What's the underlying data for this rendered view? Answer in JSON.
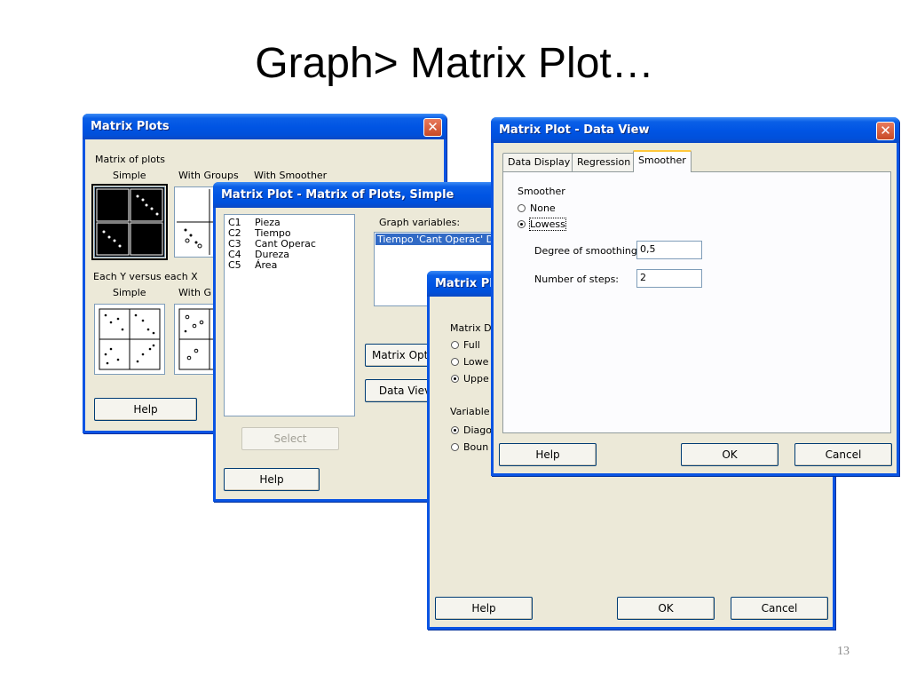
{
  "slide": {
    "title": "Graph> Matrix Plot…",
    "page_number": "13"
  },
  "matrix_plots": {
    "title": "Matrix Plots",
    "section1_label": "Matrix of plots",
    "col_simple": "Simple",
    "col_groups": "With Groups",
    "col_smoother": "With Smoother",
    "section2_label": "Each Y versus each X",
    "col2_simple": "Simple",
    "col2_groups": "With G",
    "help": "Help"
  },
  "matrix_simple": {
    "title": "Matrix Plot - Matrix of Plots, Simple",
    "columns": [
      {
        "id": "C1",
        "name": "Pieza"
      },
      {
        "id": "C2",
        "name": "Tiempo"
      },
      {
        "id": "C3",
        "name": "Cant Operac"
      },
      {
        "id": "C4",
        "name": "Dureza"
      },
      {
        "id": "C5",
        "name": "Área"
      }
    ],
    "graph_variables_label": "Graph variables:",
    "graph_variables_value": "Tiempo 'Cant Operac' Dur",
    "matrix_options": "Matrix Optio",
    "data_view": "Data Viev",
    "select": "Select",
    "help": "Help"
  },
  "matrix_options": {
    "title": "Matrix Plo",
    "display_label": "Matrix Di",
    "opt_full": "Full",
    "opt_lower": "Lowe",
    "opt_upper": "Uppe",
    "variable_label": "Variable l",
    "opt_diag": "Diago",
    "opt_bound": "Boun",
    "help": "Help",
    "ok": "OK",
    "cancel": "Cancel"
  },
  "data_view": {
    "title": "Matrix Plot - Data View",
    "tabs": [
      "Data Display",
      "Regression",
      "Smoother"
    ],
    "smoother_label": "Smoother",
    "opt_none": "None",
    "opt_lowess": "Lowess",
    "degree_label": "Degree of smoothing:",
    "degree_value": "0,5",
    "steps_label": "Number of steps:",
    "steps_value": "2",
    "help": "Help",
    "ok": "OK",
    "cancel": "Cancel"
  },
  "colors": {
    "titlebar": "#0054e3",
    "dialog_bg": "#ece9d8",
    "close": "#c84a27"
  }
}
